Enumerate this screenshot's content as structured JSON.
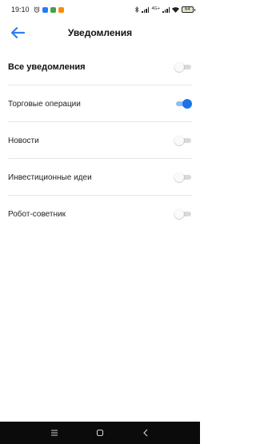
{
  "status_bar": {
    "time": "19:10",
    "network": "4G+",
    "battery": "64"
  },
  "header": {
    "title": "Уведомления"
  },
  "settings": [
    {
      "label": "Все уведомления",
      "enabled": false
    },
    {
      "label": "Торговые операции",
      "enabled": true
    },
    {
      "label": "Новости",
      "enabled": false
    },
    {
      "label": "Инвестиционные идеи",
      "enabled": false
    },
    {
      "label": "Робот-советник",
      "enabled": false
    }
  ],
  "colors": {
    "accent": "#1a73e8",
    "accent_track": "#8ebdf2",
    "back_arrow": "#2f80ed",
    "toggle_off_track": "#d9d9d9"
  }
}
